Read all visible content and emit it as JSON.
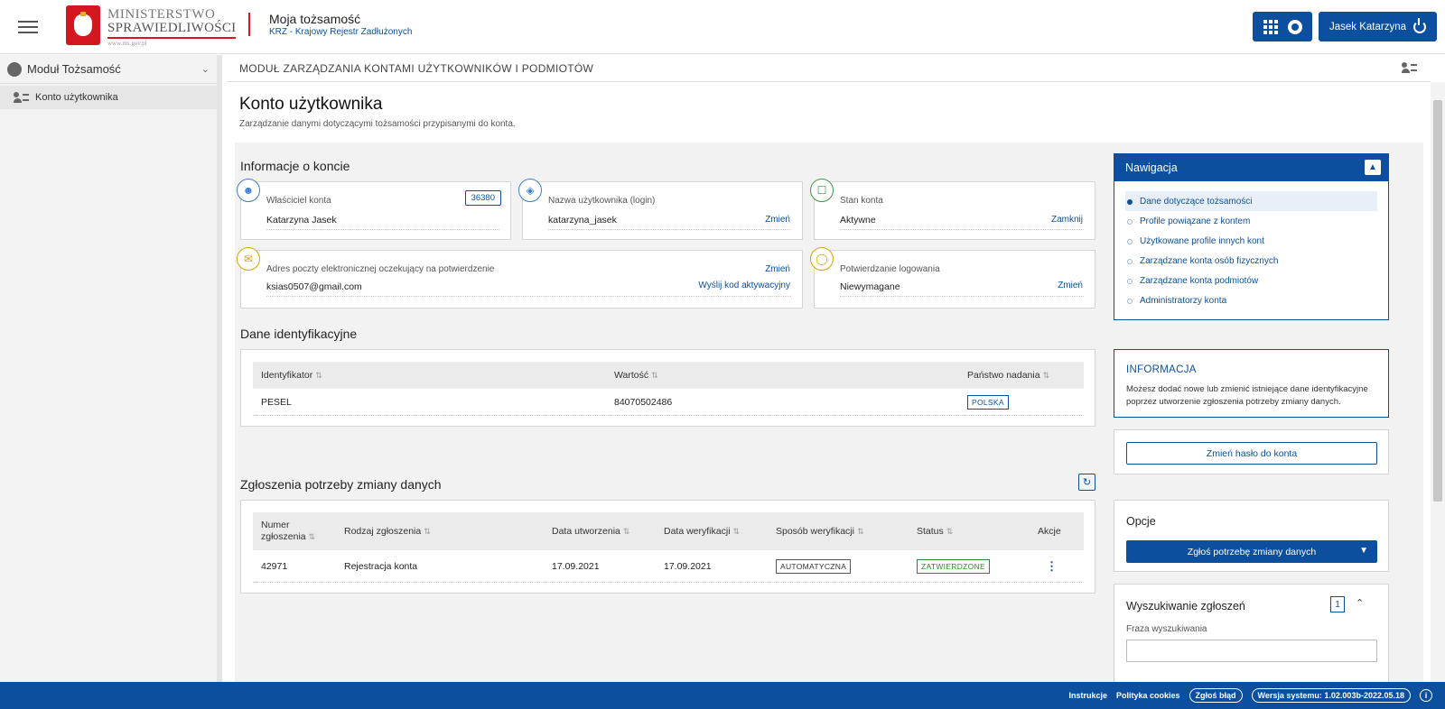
{
  "header": {
    "logo_line1": "MINISTERSTWO",
    "logo_line2": "SPRAWIEDLIWOŚCI",
    "logo_url": "www.ms.gov.pl",
    "app_title": "Moja tożsamość",
    "app_subtitle": "KRZ - Krajowy Rejestr Zadłużonych",
    "user_name": "Jasek Katarzyna"
  },
  "sidebar": {
    "module_label": "Moduł Tożsamość",
    "items": [
      {
        "label": "Konto użytkownika"
      }
    ]
  },
  "module_header": "MODUŁ ZARZĄDZANIA KONTAMI UŻYTKOWNIKÓW I PODMIOTÓW",
  "page": {
    "title": "Konto użytkownika",
    "subtitle": "Zarządzanie danymi dotyczącymi tożsamości przypisanymi do konta."
  },
  "account_info": {
    "section_title": "Informacje o koncie",
    "owner": {
      "label": "Właściciel konta",
      "value": "Katarzyna Jasek",
      "badge": "36380"
    },
    "login": {
      "label": "Nazwa użytkownika (login)",
      "value": "katarzyna_jasek",
      "link": "Zmień"
    },
    "state": {
      "label": "Stan konta",
      "value": "Aktywne",
      "link": "Zamknij"
    },
    "email": {
      "label": "Adres poczty elektronicznej oczekujący na potwierdzenie",
      "value": "ksias0507@gmail.com",
      "link1": "Zmień",
      "link2": "Wyślij kod aktywacyjny"
    },
    "login_confirm": {
      "label": "Potwierdzanie logowania",
      "value": "Niewymagane",
      "link": "Zmień"
    }
  },
  "identification": {
    "section_title": "Dane identyfikacyjne",
    "headers": [
      "Identyfikator",
      "Wartość",
      "Państwo nadania"
    ],
    "rows": [
      {
        "id": "PESEL",
        "value": "84070502486",
        "country": "POLSKA"
      }
    ]
  },
  "requests": {
    "section_title": "Zgłoszenia potrzeby zmiany danych",
    "headers": [
      "Numer zgłoszenia",
      "Rodzaj zgłoszenia",
      "Data utworzenia",
      "Data weryfikacji",
      "Sposób weryfikacji",
      "Status",
      "Akcje"
    ],
    "rows": [
      {
        "number": "42971",
        "type": "Rejestracja konta",
        "created": "17.09.2021",
        "verified": "17.09.2021",
        "method": "AUTOMATYCZNA",
        "status": "ZATWIERDZONE"
      }
    ]
  },
  "navigation": {
    "title": "Nawigacja",
    "items": [
      {
        "label": "Dane dotyczące tożsamości"
      },
      {
        "label": "Profile powiązane z kontem"
      },
      {
        "label": "Użytkowane profile innych kont"
      },
      {
        "label": "Zarządzane konta osób fizycznych"
      },
      {
        "label": "Zarządzane konta podmiotów"
      },
      {
        "label": "Administratorzy konta"
      }
    ]
  },
  "info_box": {
    "title": "INFORMACJA",
    "text": "Możesz dodać nowe lub zmienić istniejące dane identyfikacyjne poprzez utworzenie zgłoszenia potrzeby zmiany danych."
  },
  "change_password": "Zmień hasło do konta",
  "options": {
    "title": "Opcje",
    "button": "Zgłoś potrzebę zmiany danych"
  },
  "search": {
    "title": "Wyszukiwanie zgłoszeń",
    "count": "1",
    "field_label": "Fraza wyszukiwania"
  },
  "footer": {
    "instructions": "Instrukcje",
    "cookies": "Polityka cookies",
    "report": "Zgłoś błąd",
    "version": "Wersja systemu: 1.02.003b-2022.05.18"
  },
  "colors": {
    "primary": "#0b4f9e",
    "accent_red": "#d4161e"
  }
}
